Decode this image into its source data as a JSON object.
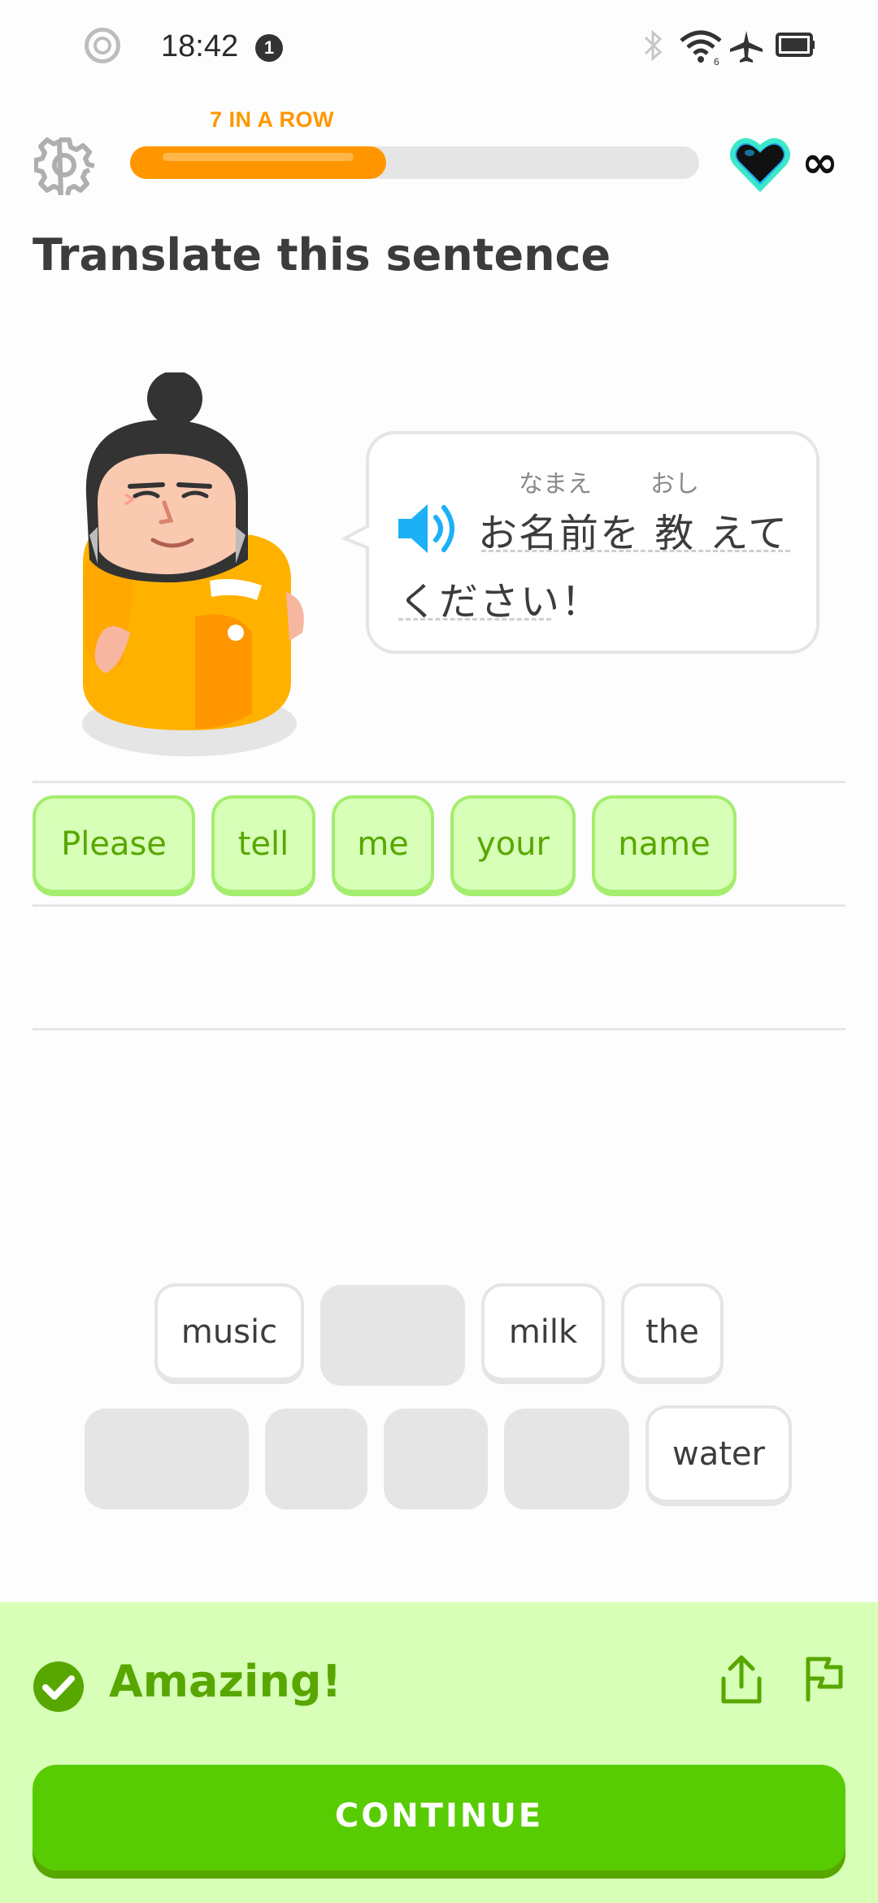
{
  "status_bar": {
    "time": "18:42",
    "notification_count": "1",
    "icons": [
      "bluetooth-icon",
      "wifi-icon",
      "airplane-mode-icon",
      "battery-icon"
    ]
  },
  "header": {
    "streak_label": "7 IN A ROW",
    "progress": 0.45,
    "hearts": "∞",
    "colors": {
      "progress": "#ff9600",
      "heart": "#1cb0f6"
    }
  },
  "prompt": {
    "title": "Translate this sentence",
    "sentence_line1": "お名前を 教 えて",
    "sentence_line2": "ください！",
    "furigana": [
      "なまえ",
      "おし"
    ]
  },
  "answer": {
    "tiles": [
      "Please",
      "tell",
      "me",
      "your",
      "name"
    ]
  },
  "word_bank": {
    "row1": [
      "music",
      "",
      "milk",
      "the"
    ],
    "row2": [
      "",
      "",
      "",
      "",
      "water"
    ]
  },
  "feedback": {
    "message": "Amazing!",
    "continue_label": "CONTINUE",
    "colors": {
      "background": "#d7ffb8",
      "text": "#58a700",
      "button": "#58cc02"
    }
  }
}
